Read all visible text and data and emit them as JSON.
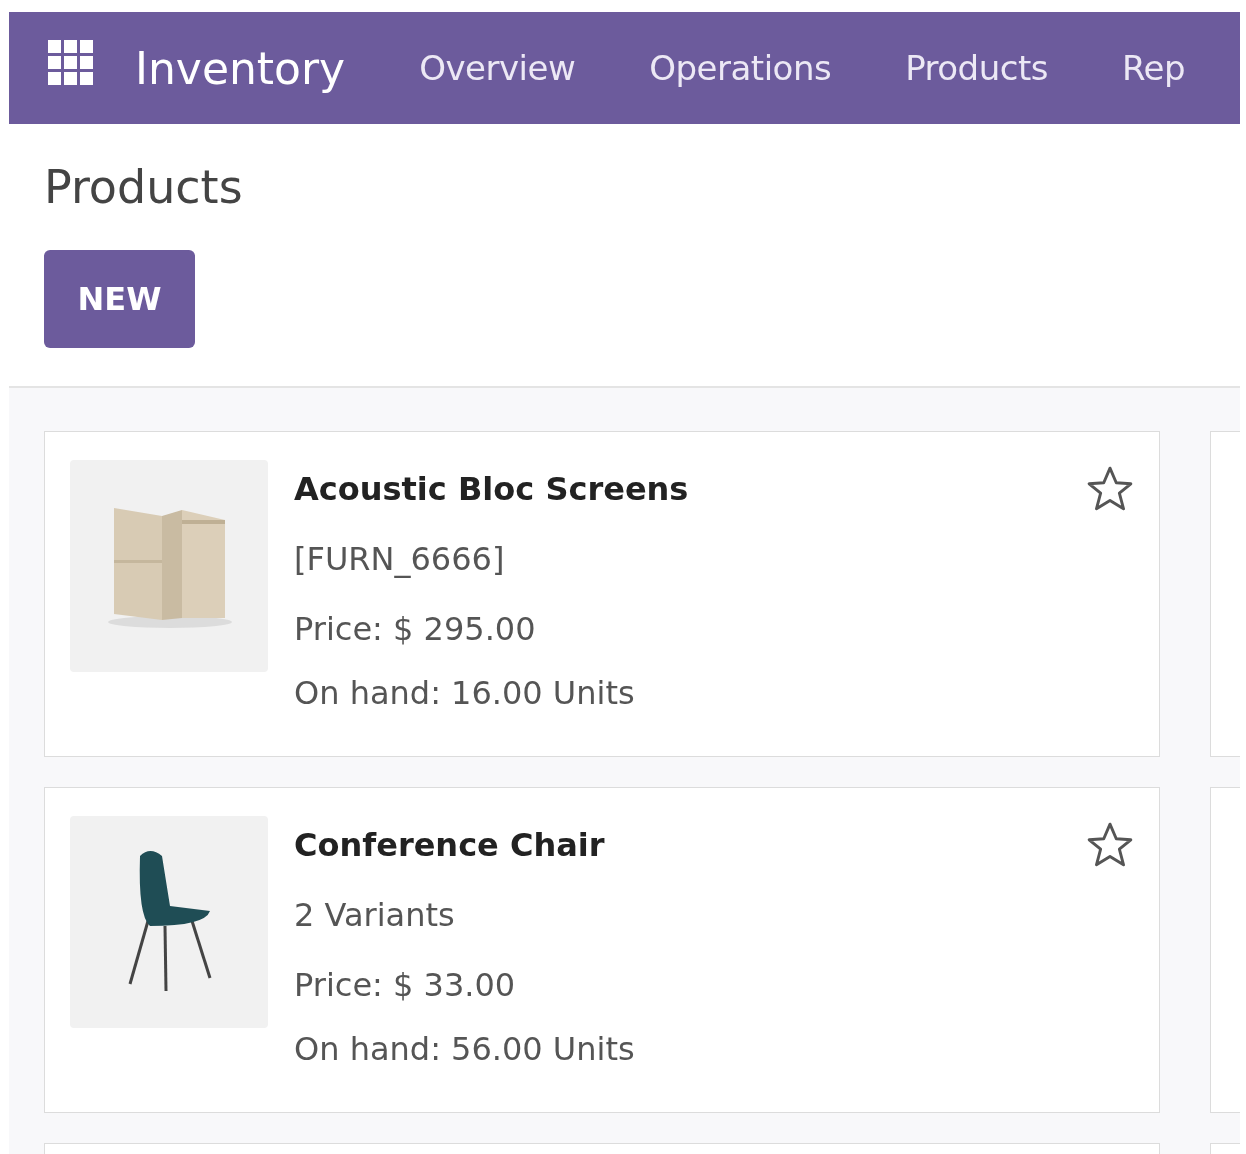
{
  "app": {
    "name": "Inventory",
    "menu": [
      {
        "label": "Overview"
      },
      {
        "label": "Operations"
      },
      {
        "label": "Products"
      },
      {
        "label": "Rep"
      }
    ]
  },
  "page": {
    "title": "Products",
    "new_button": "NEW"
  },
  "products": [
    {
      "name": "Acoustic Bloc Screens",
      "detail": "[FURN_6666]",
      "price": "Price: $ 295.00",
      "on_hand": "On hand: 16.00 Units",
      "favorite": false,
      "kind": "screen"
    },
    {
      "name": "Conference Chair",
      "detail": "2 Variants",
      "price": "Price: $ 33.00",
      "on_hand": "On hand: 56.00 Units",
      "favorite": false,
      "kind": "chair"
    }
  ]
}
